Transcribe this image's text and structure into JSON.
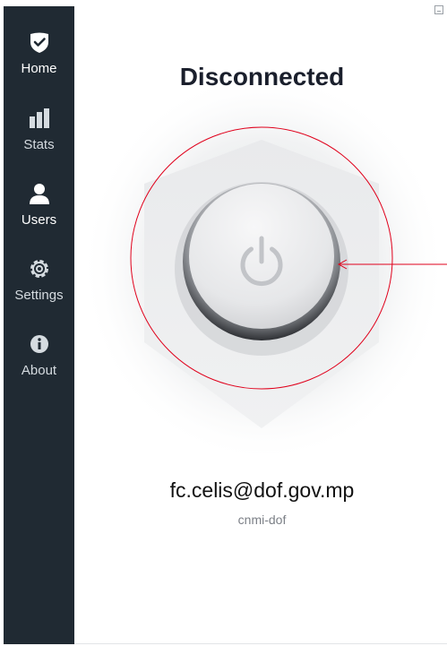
{
  "nav": {
    "items": [
      {
        "label": "Home",
        "icon": "shield-check-icon"
      },
      {
        "label": "Stats",
        "icon": "bar-chart-icon"
      },
      {
        "label": "Users",
        "icon": "user-icon"
      },
      {
        "label": "Settings",
        "icon": "gear-icon"
      },
      {
        "label": "About",
        "icon": "info-icon"
      }
    ],
    "active": "Home"
  },
  "status": {
    "text": "Disconnected"
  },
  "account": {
    "email": "fc.celis@dof.gov.mp",
    "org": "cnmi-dof"
  },
  "colors": {
    "sidebar": "#202a33",
    "annotation": "#e0001b",
    "title": "#1a1f2c"
  }
}
